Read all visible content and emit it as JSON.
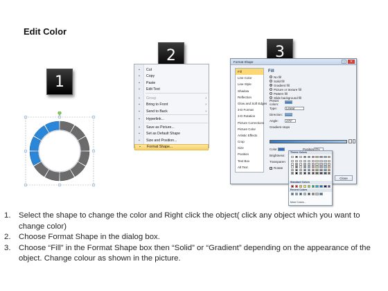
{
  "title": "Edit Color",
  "badges": [
    "1",
    "2",
    "3"
  ],
  "context_menu": {
    "items": [
      {
        "icon": "cut-icon",
        "label": "Cut",
        "disabled": false,
        "submenu": false
      },
      {
        "icon": "copy-icon",
        "label": "Copy",
        "disabled": false,
        "submenu": false
      },
      {
        "icon": "paste-icon",
        "label": "Paste",
        "disabled": false,
        "submenu": false
      },
      {
        "icon": "edit-text-icon",
        "label": "Edit Text",
        "disabled": false,
        "submenu": false
      },
      {
        "icon": "group-icon",
        "label": "Group",
        "disabled": true,
        "submenu": true
      },
      {
        "icon": "bring-front-icon",
        "label": "Bring to Front",
        "disabled": false,
        "submenu": true
      },
      {
        "icon": "send-back-icon",
        "label": "Send to Back",
        "disabled": false,
        "submenu": true
      },
      {
        "icon": "hyperlink-icon",
        "label": "Hyperlink...",
        "disabled": false,
        "submenu": false
      },
      {
        "icon": "save-picture-icon",
        "label": "Save as Picture...",
        "disabled": false,
        "submenu": false
      },
      {
        "icon": "default-shape-icon",
        "label": "Set as Default Shape",
        "disabled": false,
        "submenu": false
      },
      {
        "icon": "size-position-icon",
        "label": "Size and Position...",
        "disabled": false,
        "submenu": false
      },
      {
        "icon": "format-shape-icon",
        "label": "Format Shape...",
        "disabled": false,
        "submenu": false,
        "highlighted": true
      }
    ]
  },
  "dialog": {
    "title": "Format Shape",
    "categories": [
      "Fill",
      "Line Color",
      "Line Style",
      "Shadow",
      "Reflection",
      "Glow and Soft Edges",
      "3-D Format",
      "3-D Rotation",
      "Picture Corrections",
      "Picture Color",
      "Artistic Effects",
      "Crop",
      "Size",
      "Position",
      "Text Box",
      "Alt Text"
    ],
    "selected_category": "Fill",
    "section_title": "Fill",
    "fill_options": [
      "No fill",
      "Solid fill",
      "Gradient fill",
      "Picture or texture fill",
      "Pattern fill",
      "Slide background fill"
    ],
    "selected_fill": "Gradient fill",
    "props": {
      "preset_label": "Preset colors:",
      "type_label": "Type:",
      "type_value": "Linear",
      "direction_label": "Direction:",
      "angle_label": "Angle:",
      "angle_value": "270°",
      "stops_label": "Gradient stops",
      "color_label": "Color",
      "position_label": "Position:",
      "position_value": "0%",
      "brightness_label": "Brightness:",
      "transparency_label": "Transparen",
      "rotate_label": "Rotate"
    },
    "close_label": "Close"
  },
  "palette": {
    "theme_label": "Theme Colors",
    "standard_label": "Standard Colors",
    "recent_label": "Recent Colors",
    "more_label": "More Colors...",
    "theme_top": [
      "#ffffff",
      "#000000",
      "#eeece1",
      "#1f497d",
      "#4f81bd",
      "#c0504d",
      "#9bbb59",
      "#8064a2",
      "#4bacc6",
      "#f79646"
    ],
    "standard": [
      "#c00000",
      "#ff0000",
      "#ffc000",
      "#ffff00",
      "#92d050",
      "#00b050",
      "#00b0f0",
      "#0070c0",
      "#002060",
      "#7030a0"
    ],
    "recent": [
      "#2e75b6",
      "#5b9bd5",
      "#1f4e79",
      "#9dc3e6",
      "#404040",
      "#7f7f7f",
      "#bfbfbf",
      "#3a6ea5"
    ]
  },
  "ring": {
    "blue_segments": 4,
    "total_segments": 12,
    "accent_color": "#2a86d8",
    "gray_color": "#6b6b6b"
  },
  "instructions": [
    {
      "num": "1.",
      "text": "Select the shape to change the color and Right click the object( click any object which you want to change color)"
    },
    {
      "num": "2.",
      "text": "Choose Format Shape in the dialog box."
    },
    {
      "num": "3.",
      "text": "Choose “Fill” in the Format Shape box then “Solid” or “Gradient” depending on the appearance of the object. Change colour as shown in the picture."
    }
  ]
}
